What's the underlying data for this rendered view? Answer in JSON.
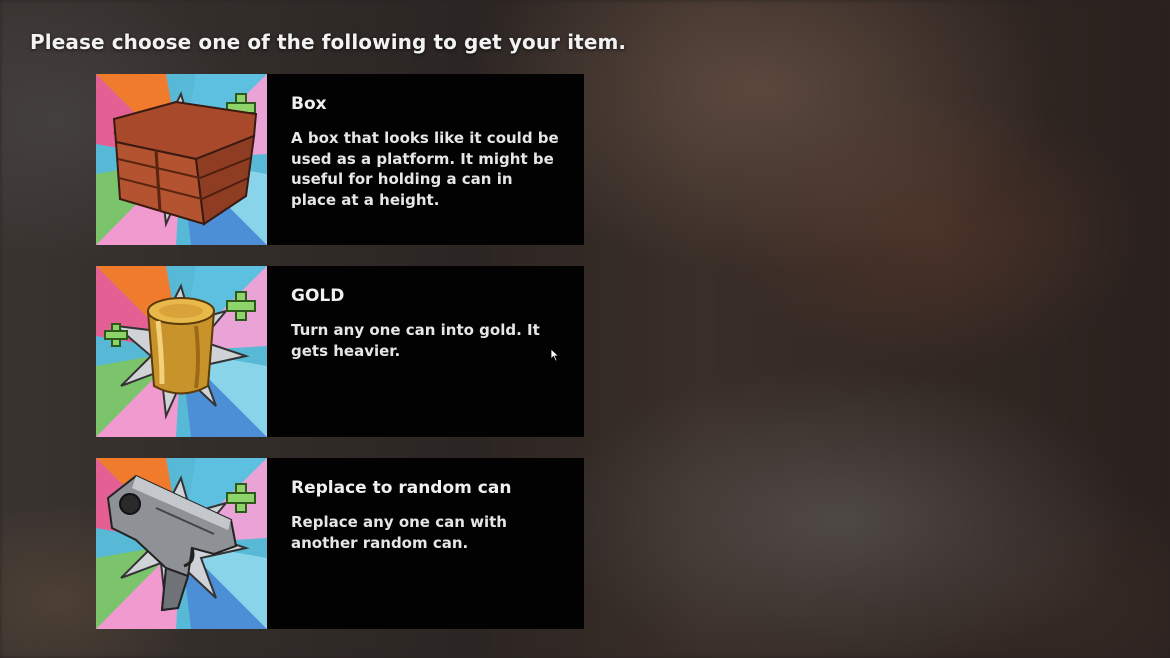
{
  "prompt": "Please choose one of the following to get your item.",
  "options": [
    {
      "title": "Box",
      "description": "A box that looks like it could be used as a platform. It might be useful for holding a can in place at a height.",
      "icon": "crate-icon"
    },
    {
      "title": "GOLD",
      "description": "Turn any one can into gold. It gets heavier.",
      "icon": "gold-can-icon"
    },
    {
      "title": "Replace to random can",
      "description": "Replace any one can with another random can.",
      "icon": "pistol-icon"
    }
  ]
}
